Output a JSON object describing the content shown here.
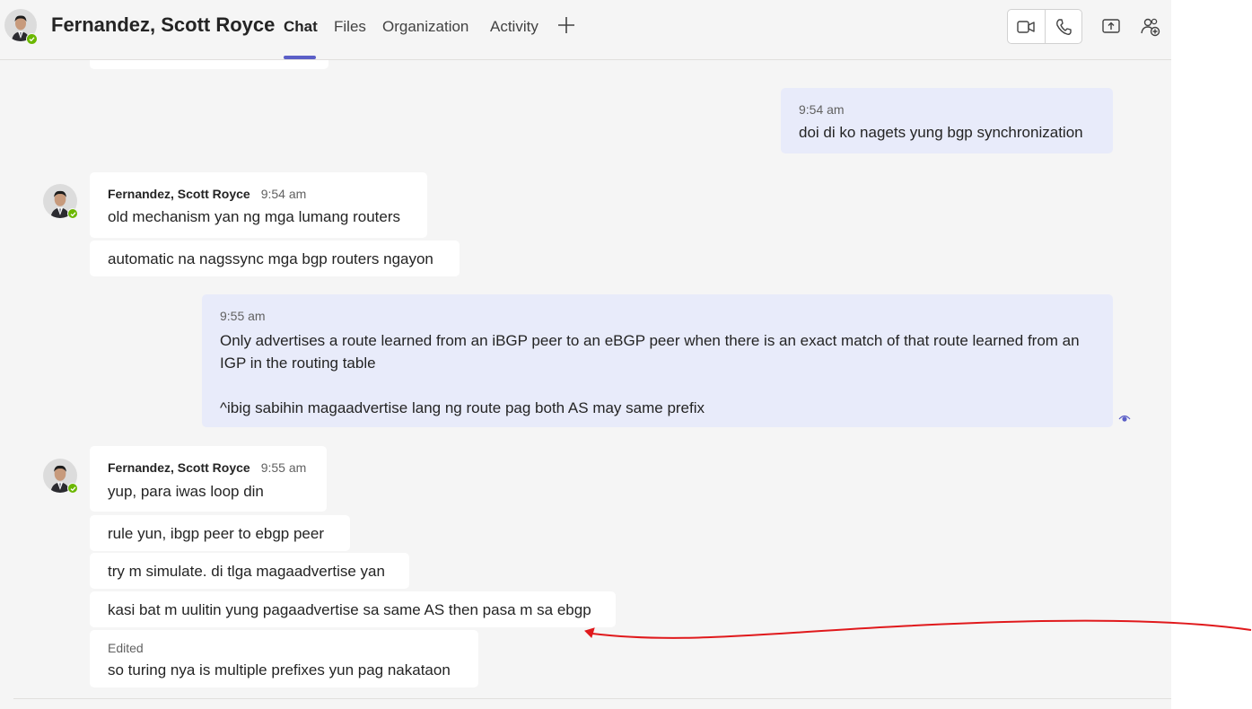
{
  "header": {
    "contact_name": "Fernandez, Scott Royce",
    "tabs": [
      {
        "label": "Chat",
        "active": true
      },
      {
        "label": "Files",
        "active": false
      },
      {
        "label": "Organization",
        "active": false
      },
      {
        "label": "Activity",
        "active": false
      }
    ],
    "icons": [
      "add-tab-icon",
      "video-call-icon",
      "audio-call-icon",
      "share-screen-icon",
      "add-people-icon"
    ],
    "accent_color": "#5b5fc7",
    "presence_color": "#6bb700"
  },
  "messages": [
    {
      "type": "sent",
      "time": "9:54 am",
      "text": "doi di ko nagets yung bgp synchronization"
    },
    {
      "type": "received",
      "sender": "Fernandez, Scott Royce",
      "time": "9:54 am",
      "lines": [
        "old mechanism yan ng mga lumang routers",
        "automatic na nagssync mga bgp routers ngayon"
      ]
    },
    {
      "type": "sent",
      "time": "9:55 am",
      "lines": [
        "Only advertises a route learned from an iBGP peer to an eBGP peer when there is an exact match of that route learned from an",
        "IGP in the routing table",
        "^ibig sabihin magaadvertise lang ng route pag both AS may same prefix"
      ]
    },
    {
      "type": "received",
      "sender": "Fernandez, Scott Royce",
      "time": "9:55 am",
      "lines": [
        "yup, para iwas loop din",
        "rule yun, ibgp peer to ebgp peer",
        "try m simulate. di tlga magaadvertise yan",
        "kasi bat m uulitin yung pagaadvertise sa same AS then pasa m sa ebgp"
      ]
    },
    {
      "type": "received-edited",
      "edited_label": "Edited",
      "text": "so turing nya is multiple prefixes yun pag nakataon"
    }
  ],
  "colors": {
    "sent_bubble": "#e8ebfa",
    "received_bubble": "#ffffff",
    "annotation_stroke": "#e0191c"
  }
}
